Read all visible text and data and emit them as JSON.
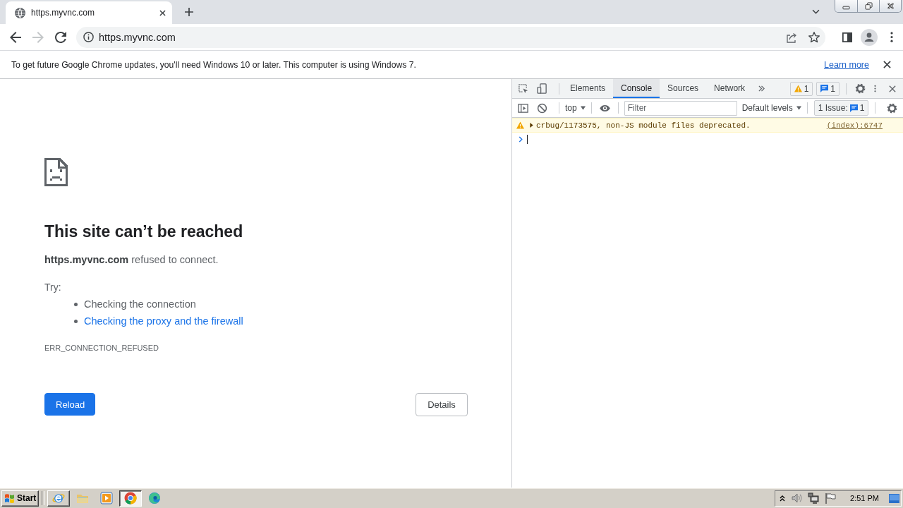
{
  "browser": {
    "tabs": [
      {
        "title": "https.myvnc.com",
        "selected": true
      }
    ],
    "back": {
      "disabled": false
    },
    "forward": {
      "disabled": true
    },
    "address": {
      "value": "https.myvnc.com"
    }
  },
  "infobar": {
    "message": "To get future Google Chrome updates, you'll need Windows 10 or later. This computer is using Windows 7.",
    "link": "Learn more"
  },
  "error_page": {
    "title": "This site can’t be reached",
    "message": "**https.myvnc.com** refused to connect.",
    "try_label": "Try:",
    "suggestions": [
      {
        "kind": "text",
        "text": "Checking the connection"
      },
      {
        "kind": "link",
        "text": "Checking the proxy and the firewall"
      }
    ],
    "error_code": "ERR_CONNECTION_REFUSED",
    "buttons": [
      {
        "kind": "primary",
        "label": "Reload"
      },
      {
        "kind": "secondary",
        "label": "Details"
      }
    ]
  },
  "devtools": {
    "tabs": [
      {
        "label": "Elements",
        "selected": false
      },
      {
        "label": "Console",
        "selected": true
      },
      {
        "label": "Sources",
        "selected": false
      },
      {
        "label": "Network",
        "selected": false
      }
    ],
    "warning_count": "1",
    "info_count": "1",
    "context": "top",
    "filter": {
      "placeholder": "Filter"
    },
    "levels": "Default levels",
    "issues_label": "1 Issue:",
    "issues_count": "1",
    "messages": [
      {
        "kind": "warning",
        "text": "crbug/1173575, non-JS module files deprecated.",
        "source": "(index):6747"
      }
    ]
  },
  "taskbar": {
    "start": "Start",
    "apps": [
      {
        "kind": "internet-explorer",
        "running": true,
        "selected": false
      },
      {
        "kind": "folder",
        "running": false,
        "selected": false
      },
      {
        "kind": "media-player",
        "running": false,
        "selected": false
      },
      {
        "kind": "chrome",
        "running": true,
        "selected": true
      },
      {
        "kind": "edge",
        "running": false,
        "selected": false
      }
    ],
    "clock": "2:51 PM"
  }
}
